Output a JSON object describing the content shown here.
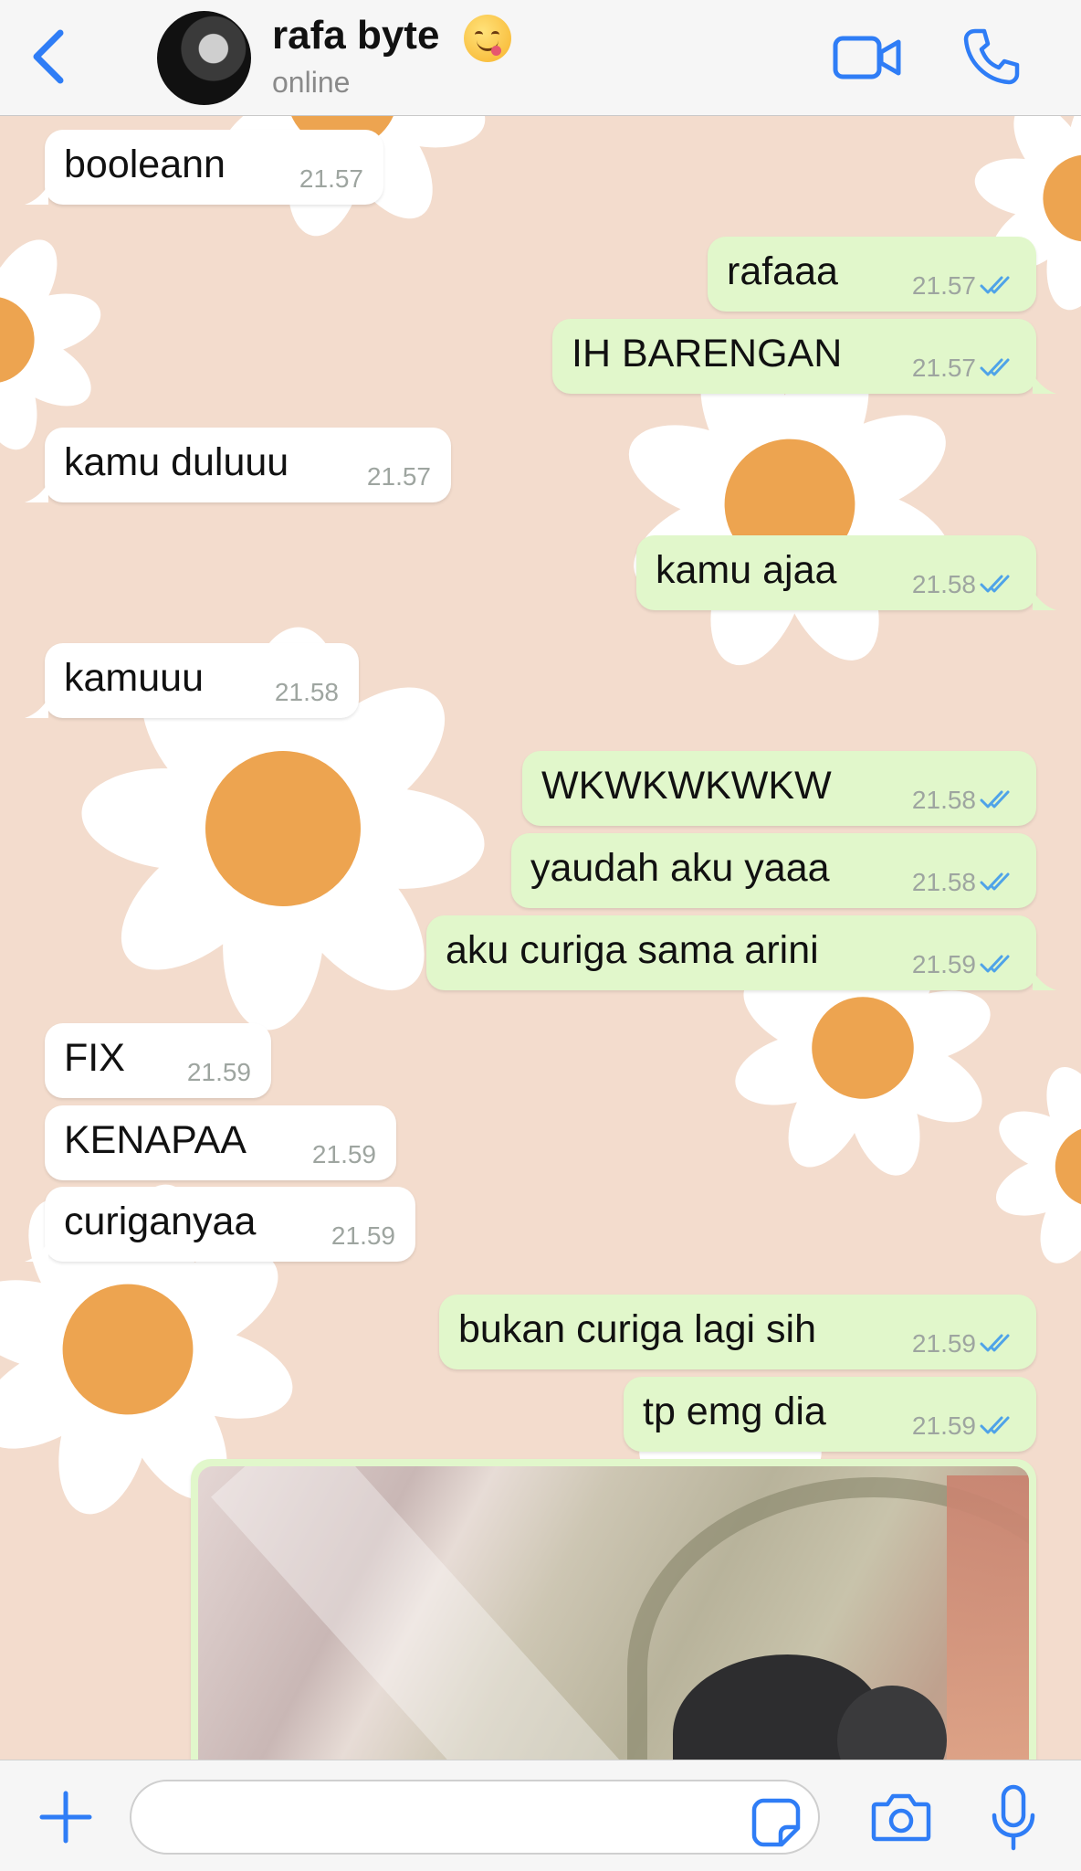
{
  "header": {
    "contact_name": "rafa byte",
    "status": "online",
    "icons": [
      "chevron-left-icon",
      "video-camera-icon",
      "phone-icon"
    ],
    "accent_color": "#2f7df6"
  },
  "messages": [
    {
      "dir": "in",
      "text": "booleann",
      "time": "21.57"
    },
    {
      "dir": "out",
      "text": "rafaaa",
      "time": "21.57"
    },
    {
      "dir": "out",
      "text": "IH BARENGAN",
      "time": "21.57"
    },
    {
      "dir": "in",
      "text": "kamu duluuu",
      "time": "21.57"
    },
    {
      "dir": "out",
      "text": "kamu ajaa",
      "time": "21.58"
    },
    {
      "dir": "in",
      "text": "kamuuu",
      "time": "21.58"
    },
    {
      "dir": "out",
      "text": "WKWKWKWKW",
      "time": "21.58"
    },
    {
      "dir": "out",
      "text": "yaudah aku yaaa",
      "time": "21.58"
    },
    {
      "dir": "out",
      "text": "aku curiga sama arini",
      "time": "21.59"
    },
    {
      "dir": "in",
      "text": "FIX",
      "time": "21.59"
    },
    {
      "dir": "in",
      "text": "KENAPAA",
      "time": "21.59"
    },
    {
      "dir": "in",
      "text": "curiganyaa",
      "time": "21.59"
    },
    {
      "dir": "out",
      "text": "bukan curiga lagi sih",
      "time": "21.59"
    },
    {
      "dir": "out",
      "text": "tp emg dia",
      "time": "21.59"
    }
  ],
  "colors": {
    "incoming_bubble": "#ffffff",
    "outgoing_bubble": "#e1f7cb",
    "read_ticks": "#4fa3e8",
    "wallpaper": "#f3dccd"
  },
  "input_bar": {
    "placeholder": "",
    "icons": [
      "plus-icon",
      "sticker-icon",
      "camera-icon",
      "microphone-icon"
    ]
  }
}
